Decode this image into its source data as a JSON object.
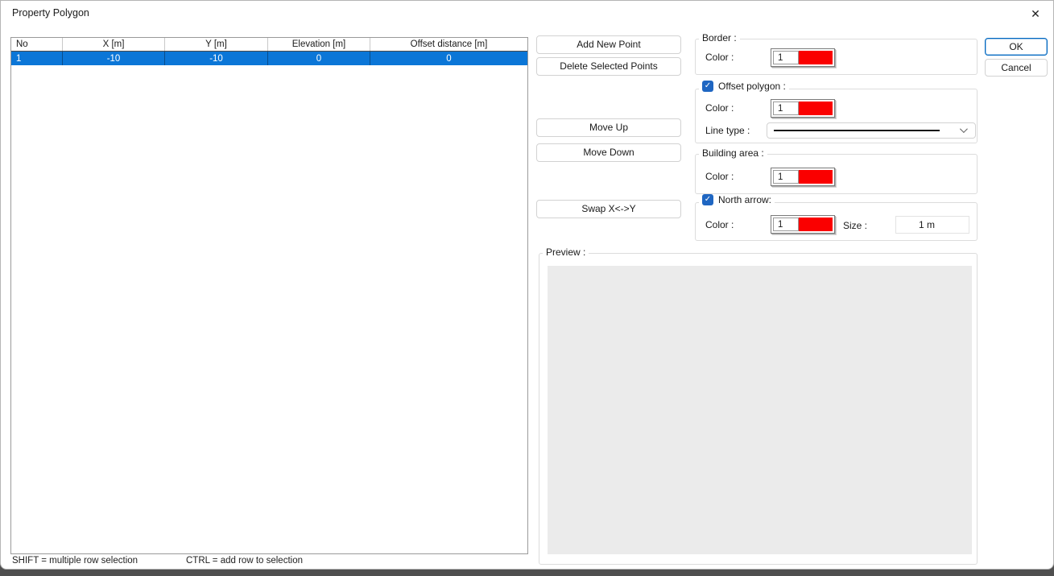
{
  "window": {
    "title": "Property Polygon",
    "close_icon": "✕"
  },
  "table": {
    "headers": [
      "No",
      "X [m]",
      "Y [m]",
      "Elevation [m]",
      "Offset distance [m]"
    ],
    "rows": [
      {
        "cells": [
          "1",
          "-10",
          "-10",
          "0",
          "0"
        ],
        "selected": true
      }
    ]
  },
  "buttons": {
    "add": "Add New Point",
    "delete": "Delete Selected Points",
    "move_up": "Move Up",
    "move_down": "Move Down",
    "swap": "Swap X<->Y",
    "ok": "OK",
    "cancel": "Cancel"
  },
  "groups": {
    "border": {
      "label": "Border :",
      "color_label": "Color :",
      "color_value": "1"
    },
    "offset_polygon": {
      "label": "Offset polygon :",
      "checked": true,
      "check_glyph": "✓",
      "color_label": "Color :",
      "color_value": "1",
      "line_type_label": "Line type :",
      "selected_line_type": "solid"
    },
    "building_area": {
      "label": "Building area :",
      "color_label": "Color :",
      "color_value": "1"
    },
    "north_arrow": {
      "label": "North arrow:",
      "checked": true,
      "check_glyph": "✓",
      "color_label": "Color :",
      "color_value": "1",
      "size_label": "Size :",
      "size_value": "1 m"
    },
    "preview": {
      "label": "Preview :"
    }
  },
  "status": {
    "shift_hint": "SHIFT = multiple row selection",
    "ctrl_hint": "CTRL = add row to selection"
  },
  "colors": {
    "selection_blue": "#0b76d7",
    "swatch_red": "#fa0000",
    "checkbox_blue": "#1f66c2",
    "ok_border": "#0067c0"
  }
}
